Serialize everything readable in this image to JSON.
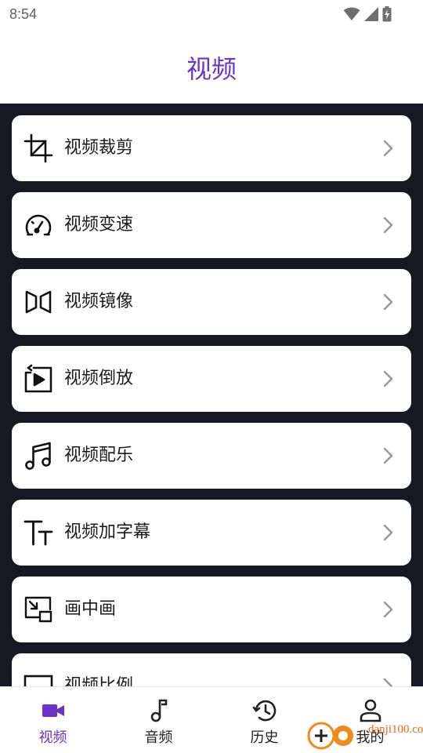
{
  "status_bar": {
    "time": "8:54"
  },
  "header": {
    "title": "视频"
  },
  "menu": [
    {
      "label": "视频裁剪",
      "icon": "crop-icon"
    },
    {
      "label": "视频变速",
      "icon": "speedometer-icon"
    },
    {
      "label": "视频镜像",
      "icon": "mirror-icon"
    },
    {
      "label": "视频倒放",
      "icon": "reverse-play-icon"
    },
    {
      "label": "视频配乐",
      "icon": "music-notes-icon"
    },
    {
      "label": "视频加字幕",
      "icon": "text-size-icon"
    },
    {
      "label": "画中画",
      "icon": "picture-in-picture-icon"
    },
    {
      "label": "视频比例",
      "icon": "aspect-ratio-icon"
    }
  ],
  "bottom_nav": [
    {
      "label": "视频",
      "icon": "video-camera-icon",
      "active": true
    },
    {
      "label": "音频",
      "icon": "music-note-icon",
      "active": false
    },
    {
      "label": "历史",
      "icon": "history-icon",
      "active": false
    },
    {
      "label": "我的",
      "icon": "person-icon",
      "active": false
    }
  ],
  "watermark": {
    "text": "danji100.com"
  },
  "colors": {
    "accent": "#6b33c9",
    "background_dark": "#161822",
    "card": "#ffffff"
  }
}
